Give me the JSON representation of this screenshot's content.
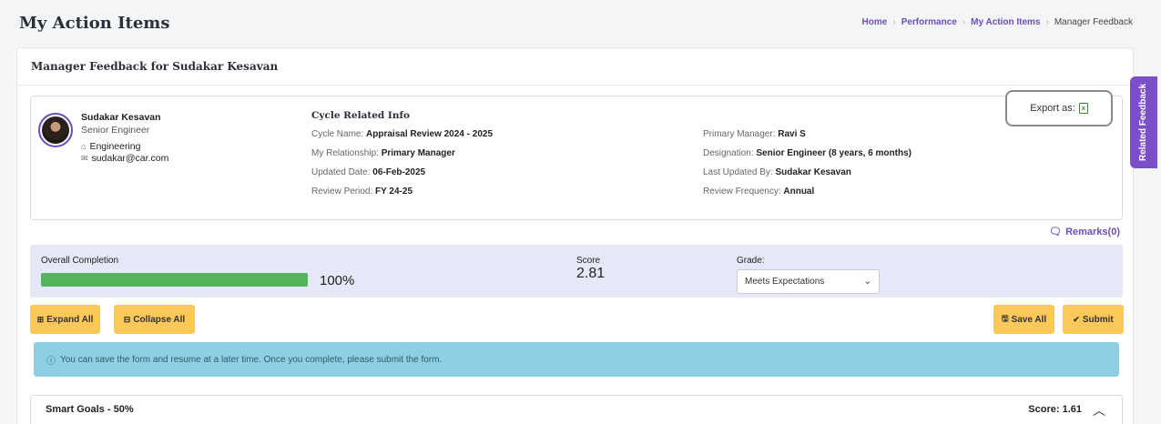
{
  "page": {
    "title": "My Action Items"
  },
  "breadcrumb": {
    "items": [
      "Home",
      "Performance",
      "My Action Items"
    ],
    "current": "Manager Feedback"
  },
  "card": {
    "header": "Manager Feedback for Sudakar Kesavan"
  },
  "profile": {
    "name": "Sudakar Kesavan",
    "role": "Senior Engineer",
    "department": "Engineering",
    "email": "sudakar@car.com"
  },
  "cycle": {
    "title": "Cycle Related Info",
    "left": [
      {
        "label": "Cycle Name:",
        "value": "Appraisal Review 2024 - 2025"
      },
      {
        "label": "My Relationship:",
        "value": "Primary Manager"
      },
      {
        "label": "Updated Date:",
        "value": "06-Feb-2025"
      },
      {
        "label": "Review Period:",
        "value": "FY 24-25"
      }
    ],
    "right": [
      {
        "label": "Primary Manager:",
        "value": "Ravi S"
      },
      {
        "label": "Designation:",
        "value": "Senior Engineer (8 years, 6 months)"
      },
      {
        "label": "Last Updated By:",
        "value": "Sudakar Kesavan"
      },
      {
        "label": "Review Frequency:",
        "value": "Annual"
      }
    ]
  },
  "export": {
    "label": "Export as:"
  },
  "remarks": {
    "label": "Remarks(0)"
  },
  "completion": {
    "label": "Overall Completion",
    "percent": 100,
    "percent_text": "100%",
    "score_label": "Score",
    "score_value": "2.81",
    "grade_label": "Grade:",
    "grade_value": "Meets Expectations"
  },
  "toolbar": {
    "expand_label": "Expand All",
    "collapse_label": "Collapse All",
    "save_label": "Save All",
    "submit_label": "Submit"
  },
  "alert": {
    "text": "You can save the form and resume at a later time. Once you complete, please submit the form."
  },
  "goals": {
    "title": "Smart Goals - 50%",
    "score": "Score: 1.61"
  },
  "side_tab": {
    "label": "Related Feedback"
  },
  "colors": {
    "accent": "#6b4fbb",
    "button": "#fcc85a",
    "progress": "#54b45e",
    "alert": "#8fcfe4",
    "side_tab": "#7b4fc8"
  }
}
